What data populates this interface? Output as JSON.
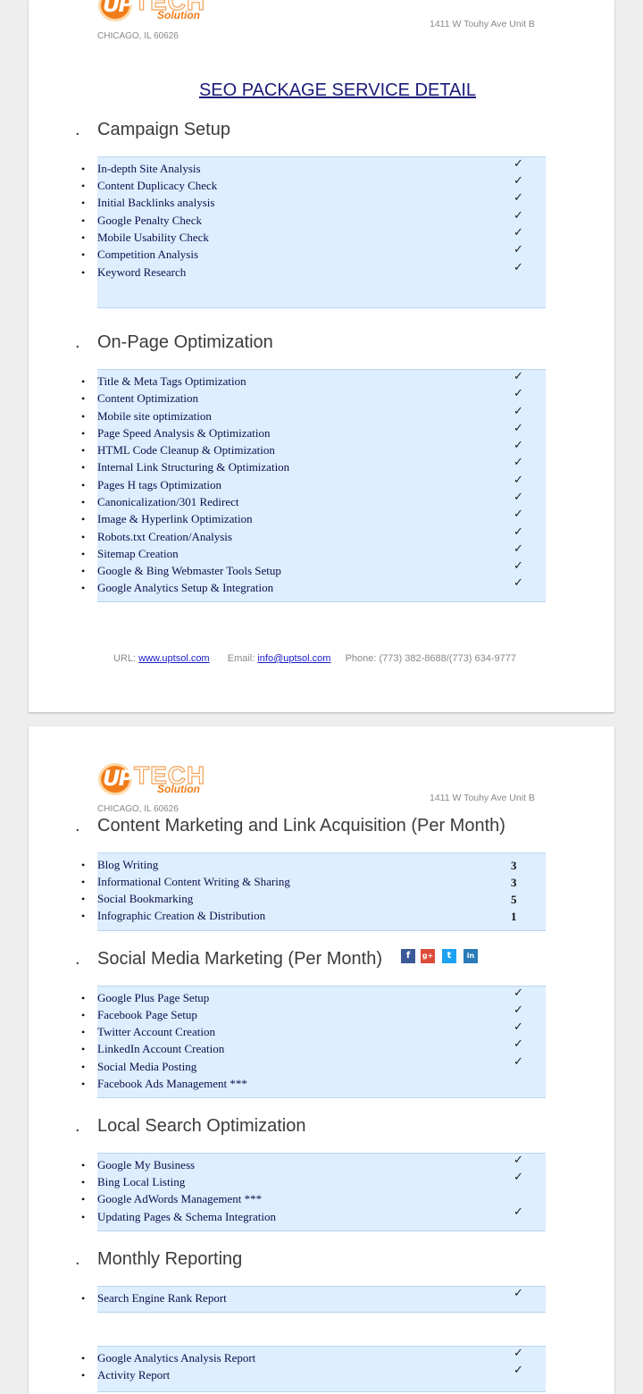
{
  "header": {
    "logo_text_up": "UP",
    "logo_text_tech": "TECH",
    "logo_text_solution": "Solution",
    "city": "CHICAGO, IL 60626",
    "address": "1411 W Touhy Ave Unit B"
  },
  "title": "SEO PACKAGE SERVICE DETAIL",
  "check_glyph": "✓",
  "bullet_glyph": "•",
  "section_dot": ".",
  "sections": {
    "campaign_setup": {
      "heading": "Campaign Setup",
      "items": [
        "In-depth Site Analysis",
        "Content Duplicacy Check",
        "Initial Backlinks analysis",
        "Google Penalty Check",
        "Mobile Usability Check",
        "Competition Analysis",
        "Keyword Research"
      ]
    },
    "on_page": {
      "heading": "On-Page Optimization",
      "items": [
        "Title & Meta Tags Optimization",
        "Content Optimization",
        "Mobile site optimization",
        "Page Speed Analysis & Optimization",
        "HTML Code Cleanup & Optimization",
        "Internal Link Structuring & Optimization",
        "Pages H tags Optimization",
        "Canonicalization/301 Redirect",
        "Image & Hyperlink Optimization",
        "Robots.txt Creation/Analysis",
        "Sitemap Creation",
        "Google & Bing Webmaster Tools Setup",
        "Google Analytics Setup & Integration"
      ]
    },
    "content_marketing": {
      "heading": "Content Marketing and Link Acquisition (Per Month)",
      "items": [
        {
          "label": "Blog Writing",
          "count": "3"
        },
        {
          "label": "Informational Content Writing & Sharing",
          "count": "3"
        },
        {
          "label": "Social Bookmarking",
          "count": "5"
        },
        {
          "label": "Infographic Creation & Distribution",
          "count": "1"
        }
      ]
    },
    "social_media": {
      "heading": "Social Media Marketing (Per Month)",
      "icons": [
        "facebook-icon",
        "google-plus-icon",
        "twitter-icon",
        "linkedin-icon"
      ],
      "icon_letters": {
        "facebook": "f",
        "google_plus": "g+",
        "twitter": "t",
        "linkedin": "in"
      },
      "items": [
        "Google Plus Page Setup",
        "Facebook Page Setup",
        "Twitter Account Creation",
        "LinkedIn Account Creation",
        "Social Media Posting",
        "Facebook Ads Management ***"
      ]
    },
    "local_search": {
      "heading": "Local Search Optimization",
      "items": [
        "Google My Business",
        "Bing Local Listing",
        "Google AdWords Management ***",
        "Updating Pages & Schema Integration"
      ]
    },
    "monthly_reporting": {
      "heading": "Monthly Reporting",
      "items": [
        "Search Engine Rank Report",
        "Google Analytics Analysis Report",
        "Activity Report"
      ]
    }
  },
  "footer": {
    "url_label": "URL:",
    "url": "www.uptsol.com",
    "email_label": "Email:",
    "email": "info@uptsol.com",
    "phone_label": "Phone:",
    "phone": "(773) 382-8688/(773) 634-9777"
  },
  "colors": {
    "box_bg": "#ddeeff",
    "title_color": "#1b1b7a",
    "logo_orange": "#f07d1a"
  }
}
